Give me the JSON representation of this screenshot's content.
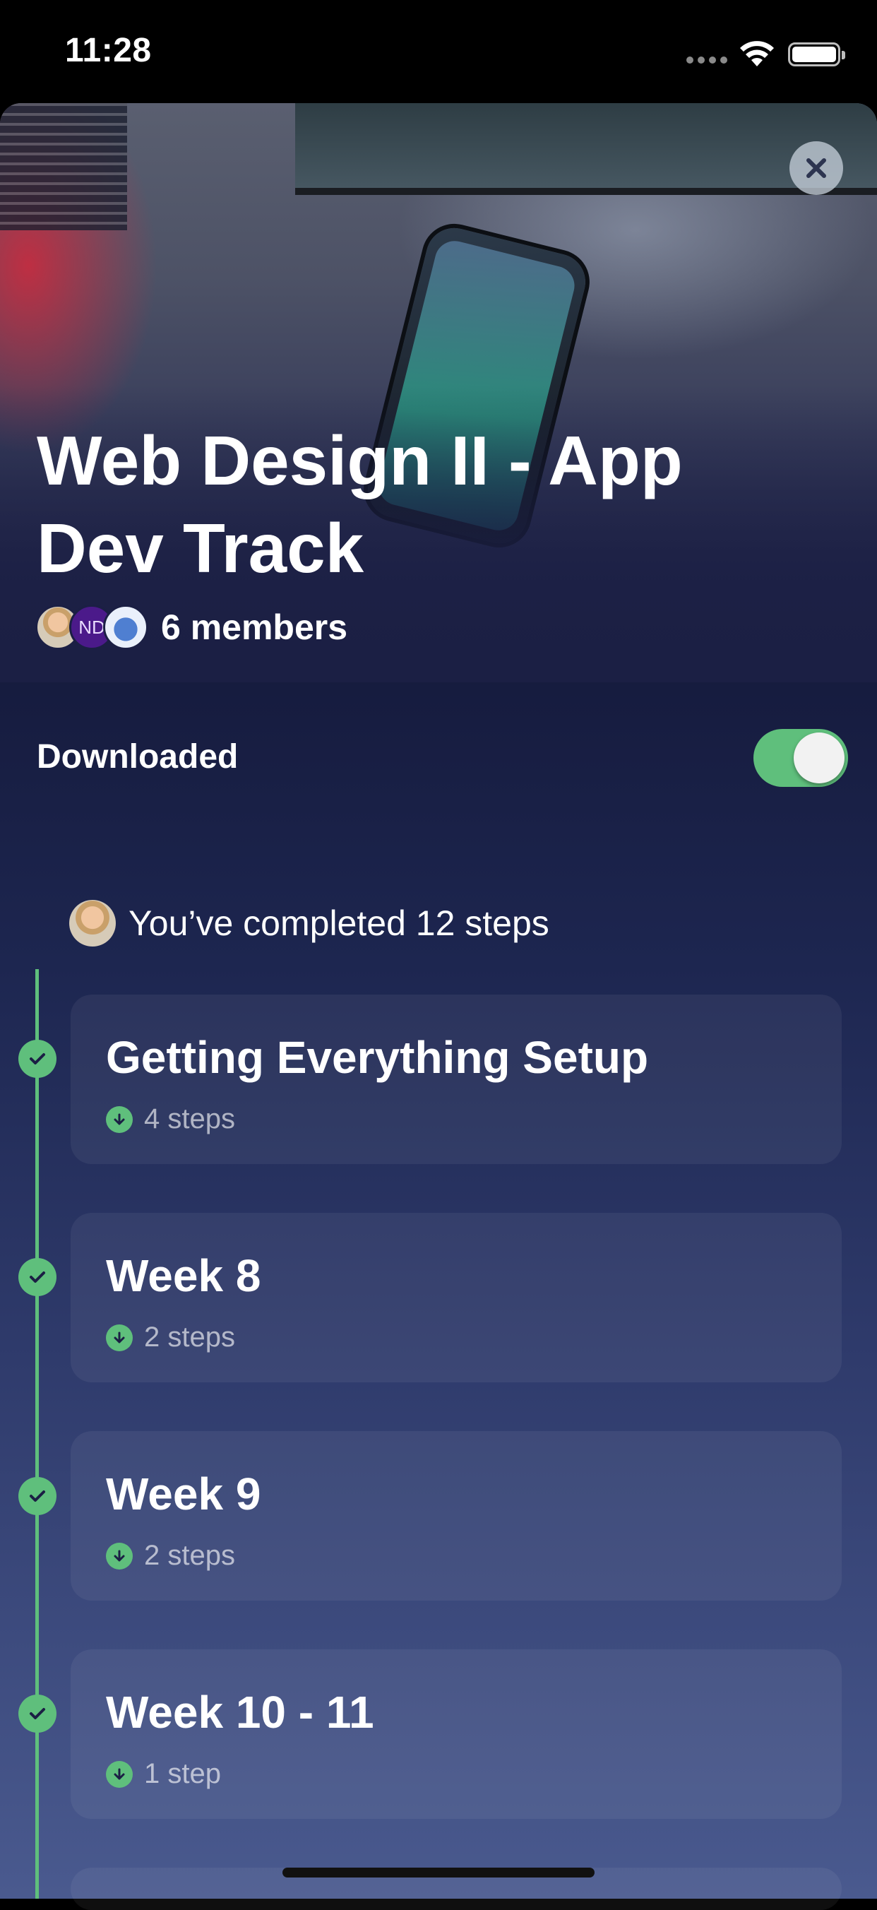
{
  "status_bar": {
    "time": "11:28"
  },
  "course": {
    "title": "Web Design II - App Dev Track",
    "members_label": "6 members",
    "avatar_initials": "ND"
  },
  "download": {
    "label": "Downloaded",
    "enabled": true
  },
  "progress": {
    "text": "You’ve completed 12 steps"
  },
  "sections": [
    {
      "title": "Getting Everything Setup",
      "steps": "4 steps"
    },
    {
      "title": "Week 8",
      "steps": "2 steps"
    },
    {
      "title": "Week 9",
      "steps": "2 steps"
    },
    {
      "title": "Week 10 - 11",
      "steps": "1 step"
    }
  ],
  "colors": {
    "accent": "#5fbf7c",
    "background_top": "#1b1f44",
    "background_bottom": "#4a5a8f"
  }
}
